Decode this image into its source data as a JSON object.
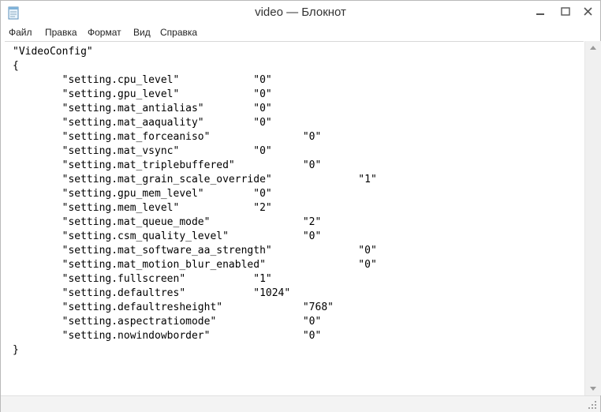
{
  "window": {
    "title": "video — Блокнот"
  },
  "menu": [
    "Файл",
    "Правка",
    "Формат",
    "Вид",
    "Справка"
  ],
  "editor": {
    "lines": [
      "\"VideoConfig\"",
      "{",
      "        \"setting.cpu_level\"            \"0\"",
      "        \"setting.gpu_level\"            \"0\"",
      "        \"setting.mat_antialias\"        \"0\"",
      "        \"setting.mat_aaquality\"        \"0\"",
      "        \"setting.mat_forceaniso\"               \"0\"",
      "        \"setting.mat_vsync\"            \"0\"",
      "        \"setting.mat_triplebuffered\"           \"0\"",
      "        \"setting.mat_grain_scale_override\"              \"1\"",
      "        \"setting.gpu_mem_level\"        \"0\"",
      "        \"setting.mem_level\"            \"2\"",
      "        \"setting.mat_queue_mode\"               \"2\"",
      "        \"setting.csm_quality_level\"            \"0\"",
      "        \"setting.mat_software_aa_strength\"              \"0\"",
      "        \"setting.mat_motion_blur_enabled\"               \"0\"",
      "        \"setting.fullscreen\"           \"1\"",
      "        \"setting.defaultres\"           \"1024\"",
      "        \"setting.defaultresheight\"             \"768\"",
      "        \"setting.aspectratiomode\"              \"0\"",
      "        \"setting.nowindowborder\"               \"0\"",
      "}"
    ]
  }
}
